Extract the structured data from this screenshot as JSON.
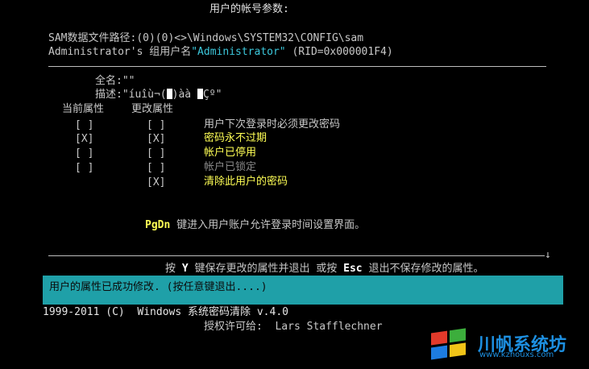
{
  "header": {
    "title": "用户的帐号参数:"
  },
  "account": {
    "sam_path_label": "SAM数据文件路径:",
    "sam_path_value": "(0)(0)<>\\Windows\\SYSTEM32\\CONFIG\\sam",
    "group_prefix": "Administrator's 组用户名",
    "group_name": "\"Administrator\"",
    "rid": " (RID=0x000001F4)",
    "fullname_label": "全名:",
    "fullname_value": "\"\"",
    "desc_label": "描述:",
    "desc_value_before": "\"íuîù¬(",
    "desc_value_after": ")àà ",
    "desc_value_tail": "Çº\""
  },
  "attributes": {
    "current_header": "当前属性",
    "change_header": "更改属性",
    "rows": [
      {
        "current": "[ ]",
        "change": "[ ]",
        "label": "用户下次登录时必须更改密码"
      },
      {
        "current": "[X]",
        "change": "[X]",
        "label": "密码永不过期"
      },
      {
        "current": "[ ]",
        "change": "[ ]",
        "label": "帐户已停用"
      },
      {
        "current": "[ ]",
        "change": "[ ]",
        "label": "帐户已锁定"
      },
      {
        "current": "",
        "change": "[X]",
        "label": "清除此用户的密码"
      }
    ]
  },
  "hints": {
    "pgdn_key": "PgDn",
    "pgdn_text": " 键进入用户账户允许登录时间设置界面。",
    "arrow": "↓",
    "save_pre": "按 ",
    "save_key": "Y",
    "save_mid": " 键保存更改的属性并退出 或按 ",
    "esc_key": "Esc",
    "save_post": " 退出不保存修改的属性。"
  },
  "status": {
    "message": "用户的属性已成功修改. (按任意键退出....)"
  },
  "footer": {
    "copyright": "1999-2011 (C)  Windows 系统密码清除 v.4.0",
    "license_label": "授权许可给:",
    "license_name": "Lars Stafflechner"
  },
  "watermark": {
    "text": "川帆系统坊",
    "url": "www.kzhouxs.com"
  },
  "colors": {
    "background": "#000000",
    "text": "#c8c8c8",
    "highlight": "#3cc8dc",
    "accent": "#ffff55",
    "status_bg": "#1fa0a8"
  }
}
